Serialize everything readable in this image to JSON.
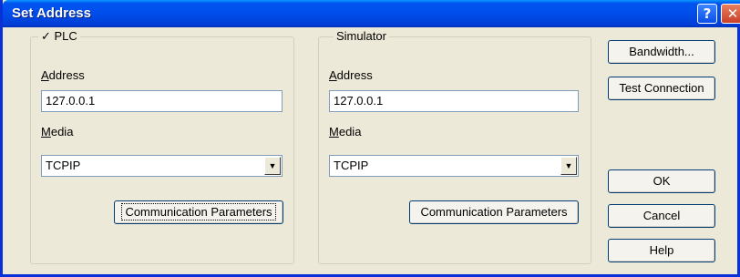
{
  "window": {
    "title": "Set Address",
    "help_glyph": "?",
    "close_glyph": "✕"
  },
  "plc": {
    "legend": "✓ PLC",
    "address_label": "Address",
    "address_value": "127.0.0.1",
    "media_label": "Media",
    "media_value": "TCPIP",
    "comm_button": "Communication Parameters"
  },
  "simulator": {
    "legend": "Simulator",
    "address_label": "Address",
    "address_value": "127.0.0.1",
    "media_label": "Media",
    "media_value": "TCPIP",
    "comm_button": "Communication Parameters"
  },
  "buttons": {
    "bandwidth": "Bandwidth...",
    "test_connection": "Test Connection",
    "ok": "OK",
    "cancel": "Cancel",
    "help": "Help"
  },
  "dropdown_glyph": "▼"
}
